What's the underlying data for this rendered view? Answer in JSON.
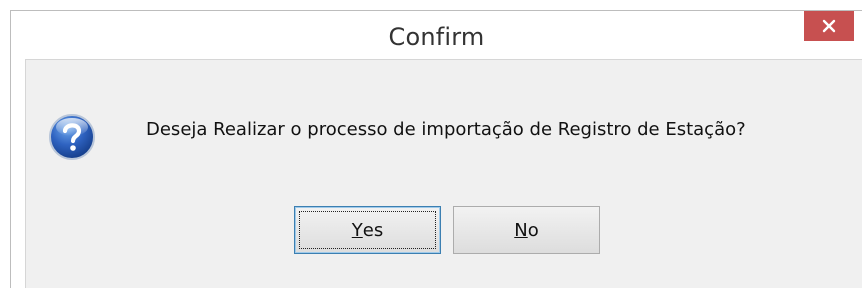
{
  "window": {
    "title": "Confirm",
    "close_icon": "close-icon"
  },
  "dialog": {
    "icon": "question-icon",
    "message": "Deseja Realizar o processo de importação de Registro de Estação?"
  },
  "buttons": {
    "yes": {
      "mnemonic": "Y",
      "rest": "es",
      "focused": true
    },
    "no": {
      "mnemonic": "N",
      "rest": "o",
      "focused": false
    }
  },
  "colors": {
    "close_button": "#c75050",
    "client_bg": "#f0f0f0",
    "focus_border": "#3c7fb1"
  }
}
